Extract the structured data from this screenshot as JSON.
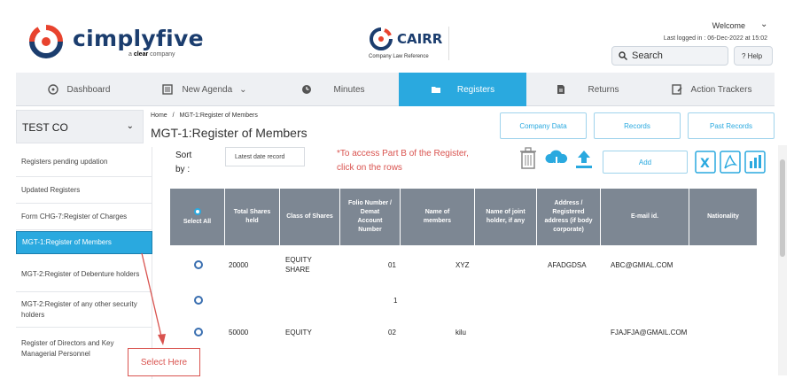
{
  "header": {
    "brand_name": "cimplyfive",
    "brand_sub_prefix": "a ",
    "brand_sub_bold": "clear",
    "brand_sub_suffix": " company",
    "partner_name": "CAIRR",
    "partner_sub": "Company Law Reference",
    "welcome": "Welcome",
    "last_logged": "Last logged in : 06-Dec-2022 at 15:02",
    "search_label": "Search",
    "help_label": "? Help"
  },
  "nav": [
    {
      "label": "Dashboard",
      "icon": "dashboard-icon"
    },
    {
      "label": "New Agenda",
      "icon": "agenda-icon"
    },
    {
      "label": "Minutes",
      "icon": "clock-icon"
    },
    {
      "label": "Registers",
      "icon": "folder-icon",
      "active": true
    },
    {
      "label": "Returns",
      "icon": "document-icon"
    },
    {
      "label": "Action Trackers",
      "icon": "tracker-icon"
    }
  ],
  "company": {
    "name": "TEST CO"
  },
  "sidebar": {
    "items": [
      {
        "label": "Registers pending updation"
      },
      {
        "label": "Updated Registers"
      },
      {
        "label": "Form CHG-7:Register of Charges"
      },
      {
        "label": "MGT-1:Register of Members",
        "active": true
      },
      {
        "label": "MGT-2:Register of Debenture holders"
      },
      {
        "label": "MGT-2:Register of any other security holders"
      },
      {
        "label": "Register of Directors and Key Managerial Personnel"
      }
    ]
  },
  "breadcrumb": {
    "home": "Home",
    "sep": "/",
    "current": "MGT-1:Register of Members"
  },
  "page_title": "MGT-1:Register of Members",
  "top_buttons": [
    "Company Data",
    "Records",
    "Past Records"
  ],
  "toolbar": {
    "sort_label_1": "Sort",
    "sort_label_2": "by :",
    "sort_value": "Latest date record",
    "note_line_1": "*To access Part B of the Register,",
    "note_line_2": "click on the rows",
    "add_label": "Add",
    "icons": [
      "trash-icon",
      "cloud-download-icon",
      "upload-icon",
      "excel-icon",
      "pdf-icon",
      "report-icon"
    ]
  },
  "table": {
    "headers": [
      [
        "Select All"
      ],
      [
        "Total Shares",
        "held"
      ],
      [
        "Class of Shares"
      ],
      [
        "Folio Number /",
        "Demat",
        "Account",
        "Number"
      ],
      [
        "Name of",
        "members"
      ],
      [
        "Name of joint",
        "holder, if any"
      ],
      [
        "Address /",
        "Registered",
        "address (if body",
        "corporate)"
      ],
      [
        "E-mail id."
      ],
      [
        "Nationality"
      ]
    ],
    "rows": [
      {
        "shares": "20000",
        "class1": "EQUITY",
        "class2": "SHARE",
        "folio": "01",
        "name": "XYZ",
        "joint": "",
        "address": "AFADGDSA",
        "email": "ABC@GMIAL.COM",
        "nationality": ""
      },
      {
        "shares": "",
        "class1": "",
        "class2": "",
        "folio": "1",
        "name": "",
        "joint": "",
        "address": "",
        "email": "",
        "nationality": ""
      },
      {
        "shares": "50000",
        "class1": "EQUITY",
        "class2": "",
        "folio": "02",
        "name": "kilu",
        "joint": "",
        "address": "",
        "email": "FJAJFJA@GMAIL.COM",
        "nationality": ""
      }
    ]
  },
  "annotation": {
    "label": "Select Here",
    "color": "#d9534f"
  },
  "colors": {
    "accent": "#2aa9df",
    "brand": "#1b3d6e",
    "brand_red": "#e8432e",
    "table_header": "#7d8793"
  }
}
